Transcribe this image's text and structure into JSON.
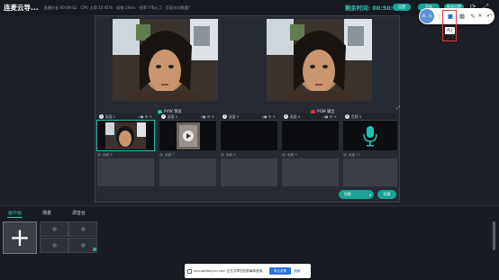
{
  "topbar": {
    "title": "连麦云导...",
    "stats": [
      "直播时长 00:09:42",
      "CPU 占用:10.41%",
      "网络:14ms",
      "帧率:??fps_5",
      "页面访问数量?"
    ],
    "timer_label": "剩余时间: 00:50:14",
    "buttons": [
      "设置",
      "开始",
      "推流设置"
    ],
    "icons": [
      "refresh-icon",
      "fullscreen-icon"
    ]
  },
  "float_toolbar": {
    "avatar_label": "讲.. 头",
    "items": [
      "menu-icon",
      "stop-icon",
      "grid-icon",
      "pen-icon",
      "close-icon",
      "undo-icon"
    ],
    "tooltip": "停止"
  },
  "previews": [
    {
      "label": "PVW 预览",
      "dot_color": "#23c1b1"
    },
    {
      "label": "PGM 输出",
      "dot_color": "#e03a3a"
    }
  ],
  "scenes": [
    {
      "num": "1",
      "name": "画面 1",
      "foot": "画面 6",
      "content": "face",
      "selected": true
    },
    {
      "num": "2",
      "name": "画面 2",
      "foot": "画面 7",
      "content": "video",
      "selected": false
    },
    {
      "num": "3",
      "name": "画面 3",
      "foot": "画面 8",
      "content": "empty",
      "selected": false
    },
    {
      "num": "4",
      "name": "画面 4",
      "foot": "画面 9",
      "content": "empty",
      "selected": false
    },
    {
      "num": "5",
      "name": "音频 5",
      "foot": "画面 10",
      "content": "mic",
      "selected": false
    }
  ],
  "actions": {
    "cut_label": "切换",
    "go_label": "切换"
  },
  "bottom": {
    "tabs": [
      "画中画",
      "场景",
      "调音台"
    ],
    "active_tab": 0,
    "add_symbol": "+"
  },
  "share_bar": {
    "text": "edu.aodianyun.com 正在共享您的屏幕和音频。",
    "stop_label": "停止共享",
    "hide_label": "隐藏"
  },
  "colors": {
    "accent": "#19a396",
    "background": "#1b1f26",
    "panel": "#262b33",
    "highlight": "#e23b3b"
  }
}
